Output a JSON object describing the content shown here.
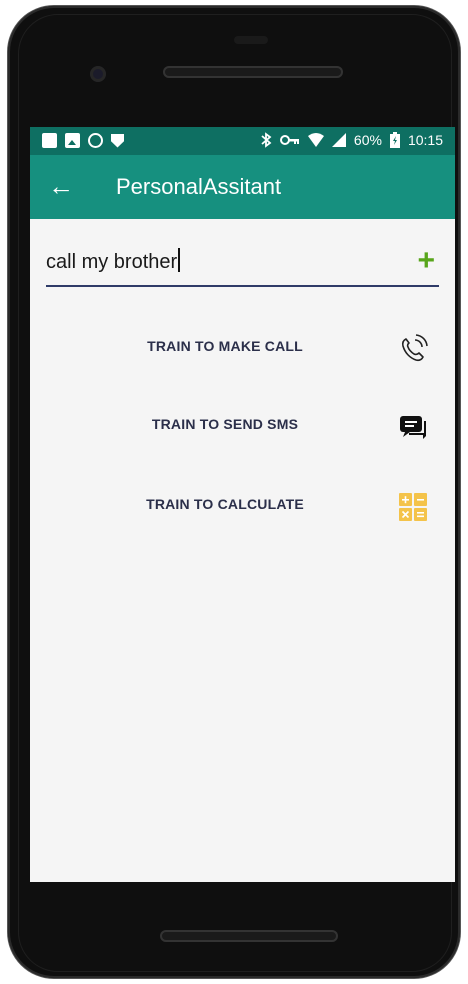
{
  "status": {
    "battery": "60%",
    "time": "10:15"
  },
  "appbar": {
    "title": "PersonalAssitant"
  },
  "command": {
    "value": "call my brother"
  },
  "actions": [
    {
      "label": "TRAIN TO MAKE CALL",
      "icon": "phone-call-icon"
    },
    {
      "label": "TRAIN TO SEND SMS",
      "icon": "chat-bubble-icon"
    },
    {
      "label": "TRAIN TO CALCULATE",
      "icon": "calculator-icon"
    }
  ],
  "colors": {
    "statusbar": "#0e6f62",
    "appbar": "#16907f",
    "accent_plus": "#58a51b",
    "underline": "#2f3b68",
    "calculator": "#f4c34a"
  }
}
